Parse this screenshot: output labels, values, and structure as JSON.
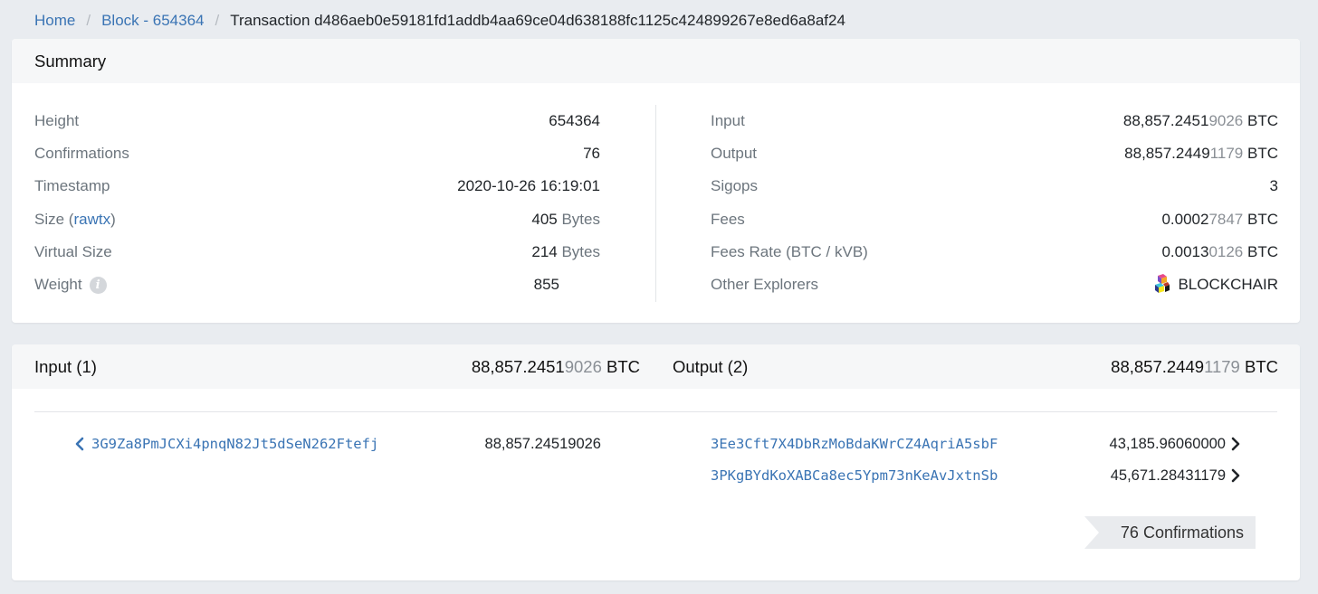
{
  "breadcrumb": {
    "home": "Home",
    "block": "Block - 654364",
    "current": "Transaction d486aeb0e59181fd1addb4aa69ce04d638188fc1125c424899267e8ed6a8af24"
  },
  "summary": {
    "title": "Summary",
    "height_label": "Height",
    "height_value": "654364",
    "confirmations_label": "Confirmations",
    "confirmations_value": "76",
    "timestamp_label": "Timestamp",
    "timestamp_value": "2020-10-26 16:19:01",
    "size_label": "Size (",
    "size_link": "rawtx",
    "size_label_close": ")",
    "size_value": "405",
    "size_unit": "Bytes",
    "vsize_label": "Virtual Size",
    "vsize_value": "214",
    "vsize_unit": "Bytes",
    "weight_label": "Weight",
    "weight_value": "855",
    "input_label": "Input",
    "input_main": "88,857.2451",
    "input_tail": "9026",
    "input_unit": "BTC",
    "output_label": "Output",
    "output_main": "88,857.2449",
    "output_tail": "1179",
    "output_unit": "BTC",
    "sigops_label": "Sigops",
    "sigops_value": "3",
    "fees_label": "Fees",
    "fees_main": "0.0002",
    "fees_tail": "7847",
    "fees_unit": "BTC",
    "feerate_label": "Fees Rate (BTC / kVB)",
    "feerate_main": "0.0013",
    "feerate_tail": "0126",
    "feerate_unit": "BTC",
    "explorers_label": "Other Explorers",
    "explorer_name": "BLOCKCHAIR"
  },
  "io": {
    "input_title": "Input (1)",
    "input_total_main": "88,857.2451",
    "input_total_tail": "9026",
    "input_total_unit": "BTC",
    "output_title": "Output (2)",
    "output_total_main": "88,857.2449",
    "output_total_tail": "1179",
    "output_total_unit": "BTC",
    "inputs": [
      {
        "address": "3G9Za8PmJCXi4pnqN82Jt5dSeN262Ftefj",
        "amount_main": "88,857.2451",
        "amount_tail": "9026"
      }
    ],
    "outputs": [
      {
        "address": "3Ee3Cft7X4DbRzMoBdaKWrCZ4AqriA5sbF",
        "amount_main": "43,185.9606",
        "amount_tail": "0000"
      },
      {
        "address": "3PKgBYdKoXABCa8ec5Ypm73nKeAvJxtnSb",
        "amount_main": "45,671.2843",
        "amount_tail": "1179"
      }
    ],
    "confirmations_badge": "76 Confirmations"
  },
  "icons": {
    "info": "info-icon",
    "blockchair": "blockchair-logo-icon",
    "chevron_left": "chevron-left-icon",
    "chevron_right": "chevron-right-icon"
  },
  "colors": {
    "link": "#3a74b4",
    "background": "#e9ecf0",
    "header": "#f6f7f8",
    "muted_digits": "#8a8f95"
  }
}
